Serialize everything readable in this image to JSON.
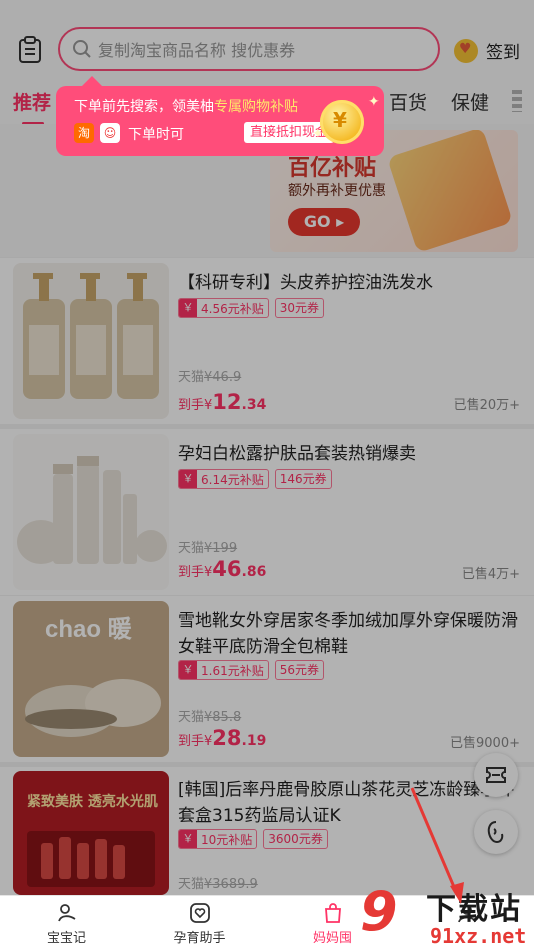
{
  "header": {
    "search_placeholder": "复制淘宝商品名称 搜优惠券",
    "signin_label": "签到"
  },
  "tabs": [
    {
      "label": "推荐"
    },
    {
      "label": "百货"
    },
    {
      "label": "保健"
    }
  ],
  "tooltip": {
    "line1_prefix": "下单前先搜索，领美柚",
    "line1_highlight": "专属购物补贴",
    "taobao_glyph": "淘",
    "line2": "下单时可",
    "cash_tag": "直接抵扣现金"
  },
  "banner": {
    "title": "百亿补贴",
    "subtitle": "额外再补更优惠",
    "go_label": "GO ▸"
  },
  "products": [
    {
      "title": "【科研专利】头皮养护控油洗发水",
      "subsidy": "4.56元补贴",
      "coupon": "30元券",
      "orig_prefix": "天猫",
      "orig_price": "¥46.9",
      "price_prefix": "到手¥",
      "price_int": "12",
      "price_dec": ".34",
      "sold": "已售20万+"
    },
    {
      "title": "孕妇白松露护肤品套装热销爆卖",
      "subsidy": "6.14元补贴",
      "coupon": "146元券",
      "orig_prefix": "天猫",
      "orig_price": "¥199",
      "price_prefix": "到手¥",
      "price_int": "46",
      "price_dec": ".86",
      "sold": "已售4万+"
    },
    {
      "title": "雪地靴女外穿居家冬季加绒加厚外穿保暖防滑女鞋平底防滑全包棉鞋",
      "subsidy": "1.61元补贴",
      "coupon": "56元券",
      "orig_prefix": "天猫",
      "orig_price": "¥85.8",
      "price_prefix": "到手¥",
      "price_int": "28",
      "price_dec": ".19",
      "sold": "已售9000+",
      "thumb_text": "chao 暖"
    },
    {
      "title": "[韩国]后率丹鹿骨胶原山茶花灵芝冻龄臻享件套盒315药监局认证K",
      "subsidy": "10元补贴",
      "coupon": "3600元券",
      "orig_prefix": "天猫",
      "orig_price": "¥3689.9",
      "thumb_text_1": "紧致美肤 透亮水光肌"
    }
  ],
  "bottom_nav": [
    {
      "label": "宝宝记",
      "icon": "baby-icon"
    },
    {
      "label": "孕育助手",
      "icon": "heart-hand-icon"
    },
    {
      "label": "妈妈囤",
      "icon": "bag-icon"
    },
    {
      "label": "",
      "icon": "profile-icon"
    }
  ],
  "watermark": {
    "nine": "9",
    "text": "下载站",
    "url": "91xz.net"
  },
  "colors": {
    "accent": "#ff3366",
    "tooltip_bg": "#ff4d7a",
    "banner_red": "#e8392f"
  }
}
